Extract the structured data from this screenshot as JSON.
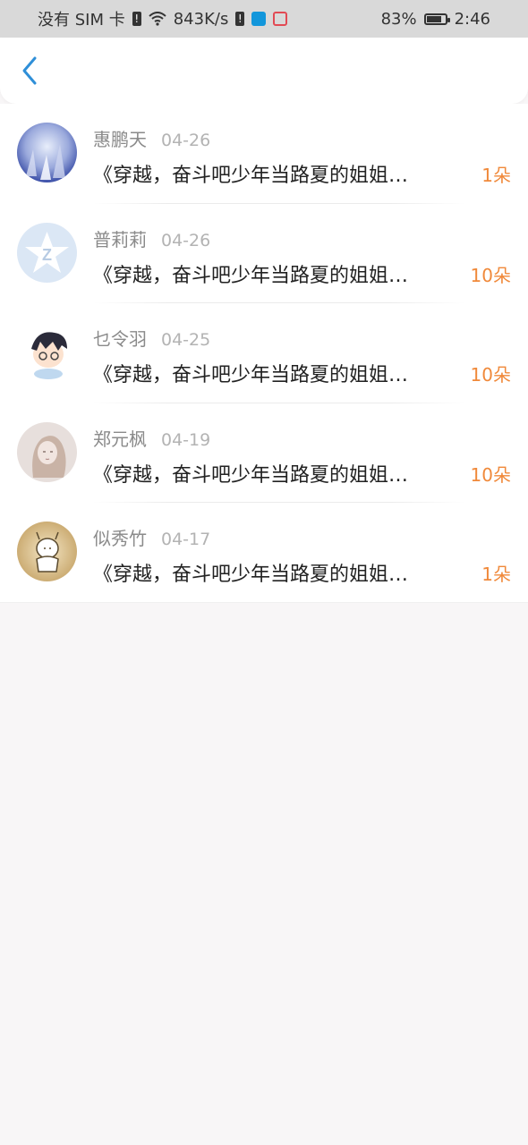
{
  "status_bar": {
    "sim": "没有 SIM 卡",
    "speed": "843K/s",
    "battery": "83%",
    "time": "2:46",
    "battery_level": 0.83
  },
  "header": {
    "back_icon": "chevron-left-icon",
    "accent": "#2f8fd8"
  },
  "list": [
    {
      "name": "惠鹏天",
      "date": "04-26",
      "title": "《穿越，奋斗吧少年当路夏的姐姐…",
      "count": "1朵",
      "avatar": "winter-scene"
    },
    {
      "name": "普莉莉",
      "date": "04-26",
      "title": "《穿越，奋斗吧少年当路夏的姐姐…",
      "count": "10朵",
      "avatar": "default-z-logo"
    },
    {
      "name": "乜令羽",
      "date": "04-25",
      "title": "《穿越，奋斗吧少年当路夏的姐姐…",
      "count": "10朵",
      "avatar": "cartoon-boy"
    },
    {
      "name": "郑元枫",
      "date": "04-19",
      "title": "《穿越，奋斗吧少年当路夏的姐姐…",
      "count": "10朵",
      "avatar": "sketch-girl"
    },
    {
      "name": "似秀竹",
      "date": "04-17",
      "title": "《穿越，奋斗吧少年当路夏的姐姐…",
      "count": "1朵",
      "avatar": "cartoon-doodle"
    }
  ],
  "colors": {
    "count": "#f0893a",
    "name": "#8a8a8a",
    "date": "#b3b3b3",
    "title": "#222222",
    "background": "#f8f6f7"
  }
}
